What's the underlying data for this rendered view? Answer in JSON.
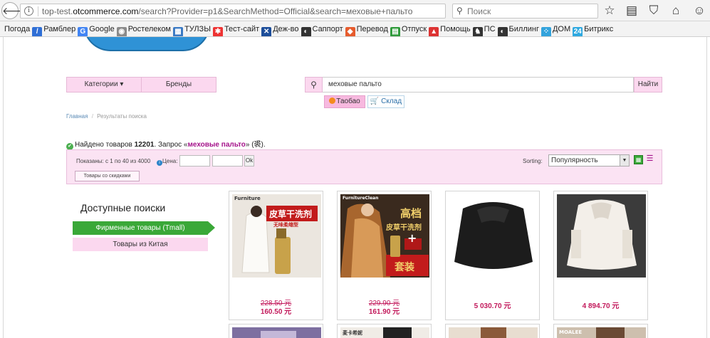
{
  "browser": {
    "url_prefix": "top-test.",
    "url_host": "otcommerce.com",
    "url_rest": "/search?Provider=p1&SearchMethod=Official&search=меховые+пальто",
    "search_placeholder": "Поиск"
  },
  "bookmarks": [
    {
      "label": "Погода",
      "icon": "",
      "color": ""
    },
    {
      "label": "Рамблер",
      "icon": "/",
      "color": "#2f6fd6"
    },
    {
      "label": "Google",
      "icon": "G",
      "color": "#4285f4"
    },
    {
      "label": "Ростелеком",
      "icon": "◉",
      "color": "#8a8a8a"
    },
    {
      "label": "ТУЛЗЫ",
      "icon": "▦",
      "color": "#3b7ac4"
    },
    {
      "label": "Тест-сайт",
      "icon": "✱",
      "color": "#e33"
    },
    {
      "label": "Деж-во",
      "icon": "✕",
      "color": "#1d4e9a"
    },
    {
      "label": "Саппорт",
      "icon": "◐",
      "color": "#333"
    },
    {
      "label": "Перевод",
      "icon": "◆",
      "color": "#e65c2e"
    },
    {
      "label": "Отпуск",
      "icon": "▤",
      "color": "#2e9a3a"
    },
    {
      "label": "Помощь",
      "icon": "▲",
      "color": "#d33"
    },
    {
      "label": "ПС",
      "icon": "♞",
      "color": "#333"
    },
    {
      "label": "Биллинг",
      "icon": "◐",
      "color": "#333"
    },
    {
      "label": "ДОМ",
      "icon": "⁘",
      "color": "#33a3dc"
    },
    {
      "label": "Битрикс",
      "icon": "24",
      "color": "#2fa9e0"
    }
  ],
  "nav": {
    "categories_label": "Категории",
    "brands_label": "Бренды"
  },
  "search": {
    "value": "меховые пальто",
    "button_label": "Найти",
    "providers": {
      "taobao": "Таобао",
      "sklad": "Склад"
    }
  },
  "breadcrumb": {
    "home": "Главная",
    "separator": "/",
    "current": "Результаты поиска"
  },
  "results": {
    "prefix": "Найдено товаров ",
    "count": "12201",
    "middle": ". Запрос «",
    "query": "меховые пальто",
    "suffix": "» (裘)."
  },
  "filter": {
    "shown": "Показаны: с 1 по 40 из 4000",
    "price_label": "Цена:",
    "ok_label": "Ok",
    "discount_label": "Товары со скидками",
    "sorting_label": "Sorting:",
    "sorting_value": "Популярность"
  },
  "facets": {
    "title": "Доступные поиски",
    "items": [
      "Фирменные товары (Tmall)",
      "Товары из Китая"
    ]
  },
  "products": [
    {
      "old_price": "228.50 元",
      "price": "160.50 元"
    },
    {
      "old_price": "229.90 元",
      "price": "161.90 元"
    },
    {
      "old_price": "",
      "price": "5 030.70 元"
    },
    {
      "old_price": "",
      "price": "4 894.70 元"
    }
  ],
  "product_image_text": {
    "p1_brand": "Furniture",
    "p1_title": "皮草干洗剂",
    "p1_sub": "无味柔缩型",
    "p2_brand": "FurnitureClean",
    "p2_title1": "高档",
    "p2_title2": "皮草干洗剂",
    "p2_plus": "+",
    "p2_set": "套装",
    "p6_label": "麦卡希妮",
    "p8_label": "MOALEE"
  },
  "colors": {
    "accent_pink": "#fbd8ef",
    "accent_green": "#3aa838",
    "price": "#c2195b"
  }
}
